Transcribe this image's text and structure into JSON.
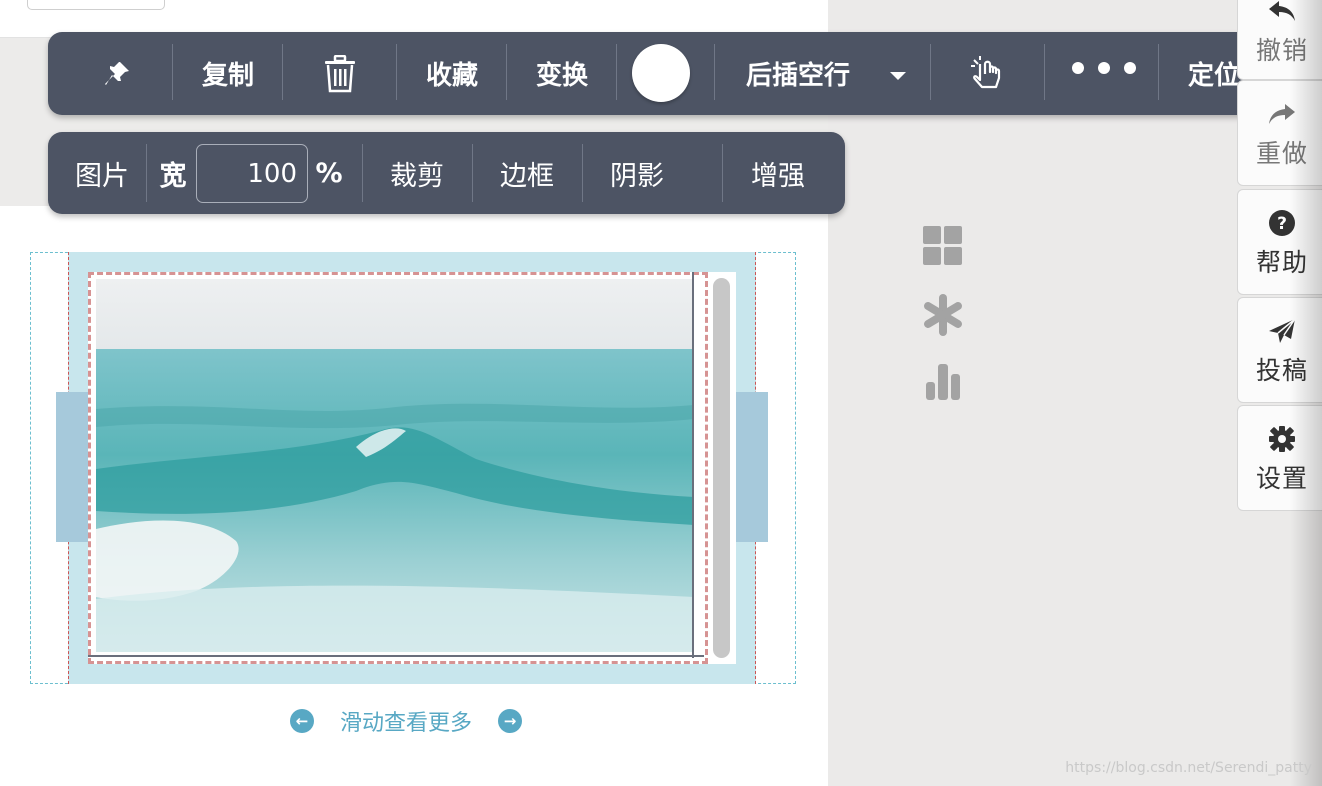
{
  "toolbar_primary": {
    "copy_label": "复制",
    "favorite_label": "收藏",
    "transform_label": "变换",
    "insert_label": "后插空行",
    "locate_label": "定位",
    "pin_icon": "pin-icon",
    "trash_icon": "trash-icon",
    "pointer_icon": "hand-pointer-icon",
    "more_icon": "more-dots-icon",
    "color_swatch": "#ffffff"
  },
  "toolbar_image": {
    "title": "图片",
    "width_label": "宽",
    "width_value": "100",
    "width_unit": "%",
    "crop_label": "裁剪",
    "border_label": "边框",
    "shadow_label": "阴影",
    "enhance_label": "增强"
  },
  "carousel": {
    "hint": "滑动查看更多",
    "prev_icon": "arrow-left-circle-icon",
    "next_icon": "arrow-right-circle-icon"
  },
  "middle_icons": [
    "grid-icon",
    "asterisk-icon",
    "bar-chart-icon"
  ],
  "right_panel": {
    "undo": "撤销",
    "redo": "重做",
    "help": "帮助",
    "submit": "投稿",
    "settings": "设置"
  },
  "watermark": "https://blog.csdn.net/Serendi_patty",
  "colors": {
    "toolbar_bg": "#4d5464",
    "accent": "#58a8c4",
    "dashed_red": "#d69393",
    "dashed_cyan": "#6cbfcf"
  }
}
